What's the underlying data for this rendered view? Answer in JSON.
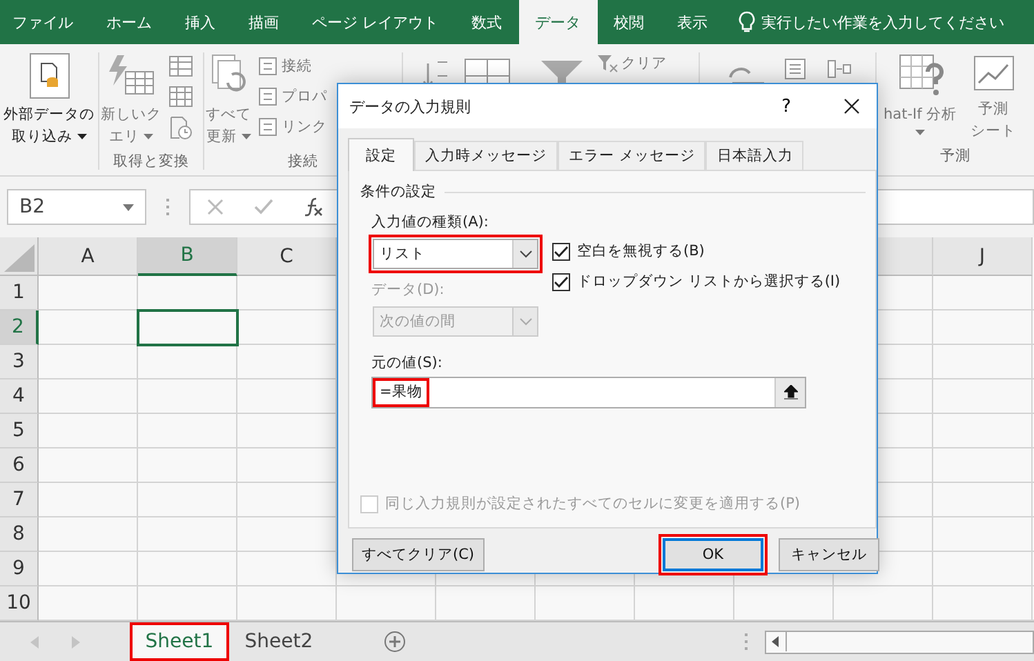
{
  "ribbon_tabs": [
    {
      "label": "ファイル",
      "selected": false
    },
    {
      "label": "ホーム",
      "selected": false
    },
    {
      "label": "挿入",
      "selected": false
    },
    {
      "label": "描画",
      "selected": false
    },
    {
      "label": "ページ レイアウト",
      "selected": false
    },
    {
      "label": "数式",
      "selected": false
    },
    {
      "label": "データ",
      "selected": true
    },
    {
      "label": "校閲",
      "selected": false
    },
    {
      "label": "表示",
      "selected": false
    }
  ],
  "tell_me": {
    "placeholder": "実行したい作業を入力してください"
  },
  "ribbon": {
    "get_external": {
      "lines": [
        "外部データの",
        "取り込み"
      ]
    },
    "new_query": {
      "lines": [
        "新しいク",
        "エリ"
      ]
    },
    "get_transform_label": "取得と変換",
    "refresh_all": {
      "lines": [
        "すべて",
        "更新"
      ]
    },
    "connection_items": [
      "接続",
      "プロパ",
      "リンク"
    ],
    "connections_label": "接続",
    "clear": "クリア",
    "what_if": "hat-If 分析",
    "forecast_sheet": {
      "lines": [
        "予測",
        "シート"
      ]
    },
    "forecast_label": "予測"
  },
  "name_box": "B2",
  "columns": [
    {
      "label": "A",
      "selected": false
    },
    {
      "label": "B",
      "selected": true
    },
    {
      "label": "C",
      "selected": false
    },
    {
      "label": "J",
      "selected": false
    }
  ],
  "rows": [
    {
      "label": "1",
      "selected": false
    },
    {
      "label": "2",
      "selected": true
    },
    {
      "label": "3",
      "selected": false
    },
    {
      "label": "4",
      "selected": false
    },
    {
      "label": "5",
      "selected": false
    },
    {
      "label": "6",
      "selected": false
    },
    {
      "label": "7",
      "selected": false
    },
    {
      "label": "8",
      "selected": false
    },
    {
      "label": "9",
      "selected": false
    },
    {
      "label": "10",
      "selected": false
    }
  ],
  "sheet_tabs": [
    {
      "label": "Sheet1",
      "selected": true,
      "highlighted": true
    },
    {
      "label": "Sheet2",
      "selected": false,
      "highlighted": false
    }
  ],
  "dialog": {
    "title": "データの入力規則",
    "help": "?",
    "tabs": [
      {
        "label": "設定",
        "selected": true
      },
      {
        "label": "入力時メッセージ",
        "selected": false
      },
      {
        "label": "エラー メッセージ",
        "selected": false
      },
      {
        "label": "日本語入力",
        "selected": false
      }
    ],
    "section": "条件の設定",
    "allow_label": "入力値の種類(A):",
    "allow": {
      "value": "リスト",
      "highlighted": true,
      "disabled": false
    },
    "checkboxes": [
      {
        "label": "空白を無視する(B)",
        "checked": true,
        "disabled": false
      },
      {
        "label": "ドロップダウン リストから選択する(I)",
        "checked": true,
        "disabled": false
      }
    ],
    "data_label": {
      "text": "データ(D):",
      "disabled": true
    },
    "data": {
      "value": "次の値の間",
      "highlighted": false,
      "disabled": true
    },
    "source_label": "元の値(S):",
    "source": {
      "value": "=果物",
      "highlighted": true
    },
    "apply_all": {
      "label": "同じ入力規則が設定されたすべてのセルに変更を適用する(P)",
      "checked": false,
      "disabled": true
    },
    "buttons": [
      {
        "label": "すべてクリア(C)",
        "kind": "left",
        "default": false,
        "highlighted": false
      },
      {
        "label": "OK",
        "kind": "right",
        "default": true,
        "highlighted": true
      },
      {
        "label": "キャンセル",
        "kind": "right",
        "default": false,
        "highlighted": false
      }
    ]
  }
}
